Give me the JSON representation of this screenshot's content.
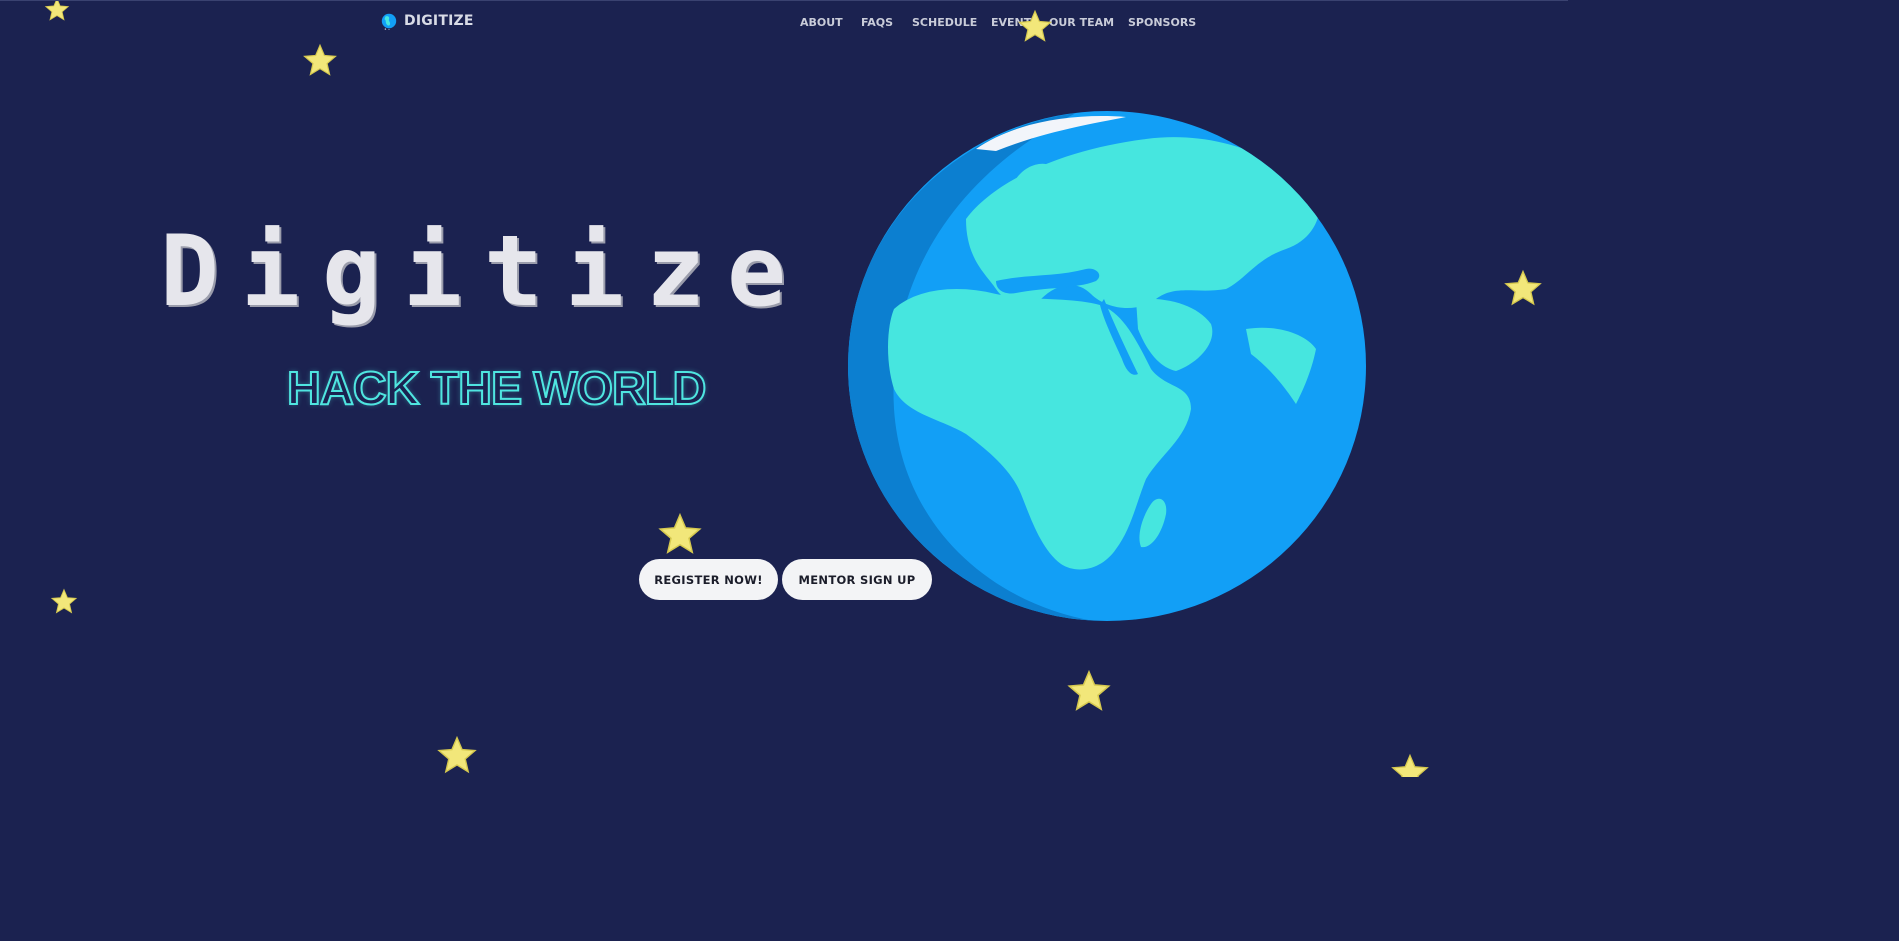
{
  "brand": {
    "name": "DIGITIZE",
    "logo_icon": "globe-icon"
  },
  "nav": {
    "items": [
      {
        "label": "ABOUT"
      },
      {
        "label": "FAQS"
      },
      {
        "label": "SCHEDULE"
      },
      {
        "label": "EVENT"
      },
      {
        "label": "OUR TEAM"
      },
      {
        "label": "SPONSORS"
      }
    ]
  },
  "hero": {
    "title": "Digitize",
    "tagline": "HACK THE WORLD",
    "illustration": "earth-globe",
    "decoration": "star-icon"
  },
  "actions": {
    "register_label": "REGISTER NOW!",
    "mentor_label": "MENTOR SIGN UP"
  },
  "colors": {
    "background": "#1b2250",
    "ocean": "#129ff6",
    "land": "#46e6df",
    "star": "#f2e77a",
    "button_bg": "#f3f4f6",
    "tagline_outline": "#4fe5e0"
  }
}
